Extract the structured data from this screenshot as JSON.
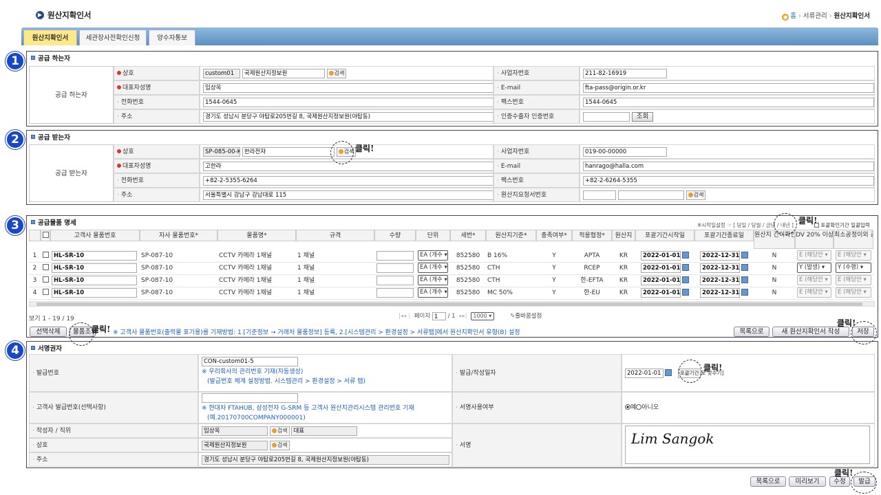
{
  "page_title": "원산지확인서",
  "breadcrumb": {
    "home": "홈",
    "items": [
      "서류관리",
      "원산지확인서"
    ]
  },
  "tabs": [
    "원산지확인서",
    "세관장사전확인신청",
    "양수자통보"
  ],
  "steps": [
    "1",
    "2",
    "3",
    "4"
  ],
  "click_label": "클릭!",
  "supplier": {
    "title": "공급 하는자",
    "side": "공급 하는자",
    "labels": {
      "name": "상호",
      "ceo": "대표자성명",
      "tel": "전화번호",
      "addr": "주소",
      "bizno": "사업자번호",
      "email": "E-mail",
      "fax": "팩스번호",
      "cert": "인증수출자 인증번호"
    },
    "code": "custom01",
    "name": "국제원산지정보원",
    "search": "검색",
    "ceo": "임상옥",
    "tel": "1544-0645",
    "addr": "경기도 성남시 분당구 야탑로205번길 8, 국제원산지정보원(야탑동)",
    "bizno": "211-82-16919",
    "email": "fta-pass@origin.or.kr",
    "fax": "1544-0645",
    "cert": "",
    "lookup": "조회"
  },
  "buyer": {
    "title": "공급 받는자",
    "side": "공급 받는자",
    "labels": {
      "name": "상호",
      "ceo": "대표자성명",
      "tel": "전화번호",
      "addr": "주소",
      "bizno": "사업자번호",
      "email": "E-mail",
      "fax": "팩스번호",
      "req": "원산지요청서번호"
    },
    "code": "SP-085-00-K",
    "name": "한라전자",
    "search": "검색",
    "ceo": "고한라",
    "tel": "+82-2-5355-6264",
    "addr": "서울특별시 강남구 강남대로 115",
    "bizno": "019-00-00000",
    "email": "hanrago@halla.com",
    "fax": "+82-2-6264-5355",
    "req": ""
  },
  "items": {
    "title": "공급물품 명세",
    "toolbar_note": "※시작일설정 ☞ [ 당일 / 당월 / 금년 / 내년 ]",
    "bulk_label": "포괄확인기간 일괄입력",
    "headers": [
      "고객사 물품번호",
      "자사 물품번호*",
      "물품명*",
      "규격",
      "수량",
      "단위",
      "세번*",
      "원산지기준*",
      "충족여부*",
      "적용협정*",
      "원산지",
      "포괄기간시작일",
      "포괄기간종료일",
      "원산지 간이확인물품",
      "DV 20% 이상발생여부",
      "최소공정이외 공정수행여부"
    ],
    "rows": [
      {
        "no": "1",
        "cust": "HL-SR-10",
        "own": "SP-087-10",
        "name": "CCTV 카메라 1채널",
        "spec": "1 채널",
        "qty": "",
        "unit": "EA (개수",
        "hs": "852580",
        "crit": "B 16%",
        "ok": "Y",
        "fta": "APTA",
        "origin": "KR",
        "start": "2022-01-01",
        "end": "2022-12-31",
        "simple": "N",
        "dv": "E (해당안",
        "min": "E (해당안",
        "dv_active": false,
        "min_active": false
      },
      {
        "no": "2",
        "cust": "HL-SR-10",
        "own": "SP-087-10",
        "name": "CCTV 카메라 1채널",
        "spec": "1 채널",
        "qty": "",
        "unit": "EA (개수",
        "hs": "852580",
        "crit": "CTH",
        "ok": "Y",
        "fta": "RCEP",
        "origin": "KR",
        "start": "2022-01-01",
        "end": "2022-12-31",
        "simple": "N",
        "dv": "Y (발생)",
        "min": "Y (수행)",
        "dv_active": true,
        "min_active": true
      },
      {
        "no": "3",
        "cust": "HL-SR-10",
        "own": "SP-087-10",
        "name": "CCTV 카메라 1채널",
        "spec": "1 채널",
        "qty": "",
        "unit": "EA (개수",
        "hs": "852580",
        "crit": "CTH",
        "ok": "Y",
        "fta": "한-EFTA",
        "origin": "KR",
        "start": "2022-01-01",
        "end": "2022-12-31",
        "simple": "N",
        "dv": "E (해당안",
        "min": "E (해당안",
        "dv_active": false,
        "min_active": false
      },
      {
        "no": "4",
        "cust": "HL-SR-10",
        "own": "SP-087-10",
        "name": "CCTV 카메라 1채널",
        "spec": "1 채널",
        "qty": "",
        "unit": "EA (개수",
        "hs": "852580",
        "crit": "MC 50%",
        "ok": "Y",
        "fta": "한-EU",
        "origin": "KR",
        "start": "2022-01-01",
        "end": "2022-12-31",
        "simple": "N",
        "dv": "E (해당안",
        "min": "E (해당안",
        "dv_active": false,
        "min_active": false
      }
    ],
    "view_count": "보기 1 - 19 / 19",
    "pager": {
      "label": "페이지",
      "page": "1",
      "total": "/ 1",
      "per_page": "1000"
    },
    "sort_label": "줄바꿈설정",
    "btn_delete": "선택삭제",
    "btn_lookup": "물품조회",
    "notice": "※ 고객사 물품번호(출력물 표기용)를 기재방법: 1.[기준정보 → 거래처 물품정보] 등록, 2.[시스템관리 > 환경설정 > 서류탭]에서 원산지확인서 유형(B) 설정",
    "btn_list": "목록으로",
    "btn_new": "새 원산지확인서 작성",
    "btn_save": "저장"
  },
  "signer": {
    "title": "서명권자",
    "issue_no_label": "발급번호",
    "issue_no": "CON-custom01-5",
    "issue_note1": "※ 우리회사의 관리번호 기재(자동생성)",
    "issue_note2": "(발급번호 체계 설정방법. 시스템관리 > 환경설정 > 서류 탭)",
    "cust_no_label": "고객사 발급번호(선택사항)",
    "cust_no": "",
    "cust_note1": "※ 현대차 FTAHUB, 삼성전자 G-SRM 등 고객사 원산지관리시스템 관리번호 기재",
    "cust_note2": "(예.20170700COMPANY000001)",
    "writer_label": "작성자 / 직위",
    "writer": "임상옥",
    "position": "대표",
    "search": "검색",
    "company_label": "상호",
    "company": "국제원산지정보원",
    "addr_label": "주소",
    "addr": "경기도 성남시 분당구 야탑로205번길 8, 국제원산지정보원(야탑동)",
    "date_label": "발급/작성일자",
    "date": "2022-01-01",
    "date_btn": "포괄기간",
    "date_suffix": "로 맞추기]",
    "sig_use_label": "서명사용여부",
    "yes": "예",
    "no": "아니오",
    "sig_label": "서명",
    "signature": "Lim Sangok"
  },
  "bottom": {
    "list": "목록으로",
    "preview": "미리보기",
    "edit": "수정",
    "issue": "발급"
  }
}
